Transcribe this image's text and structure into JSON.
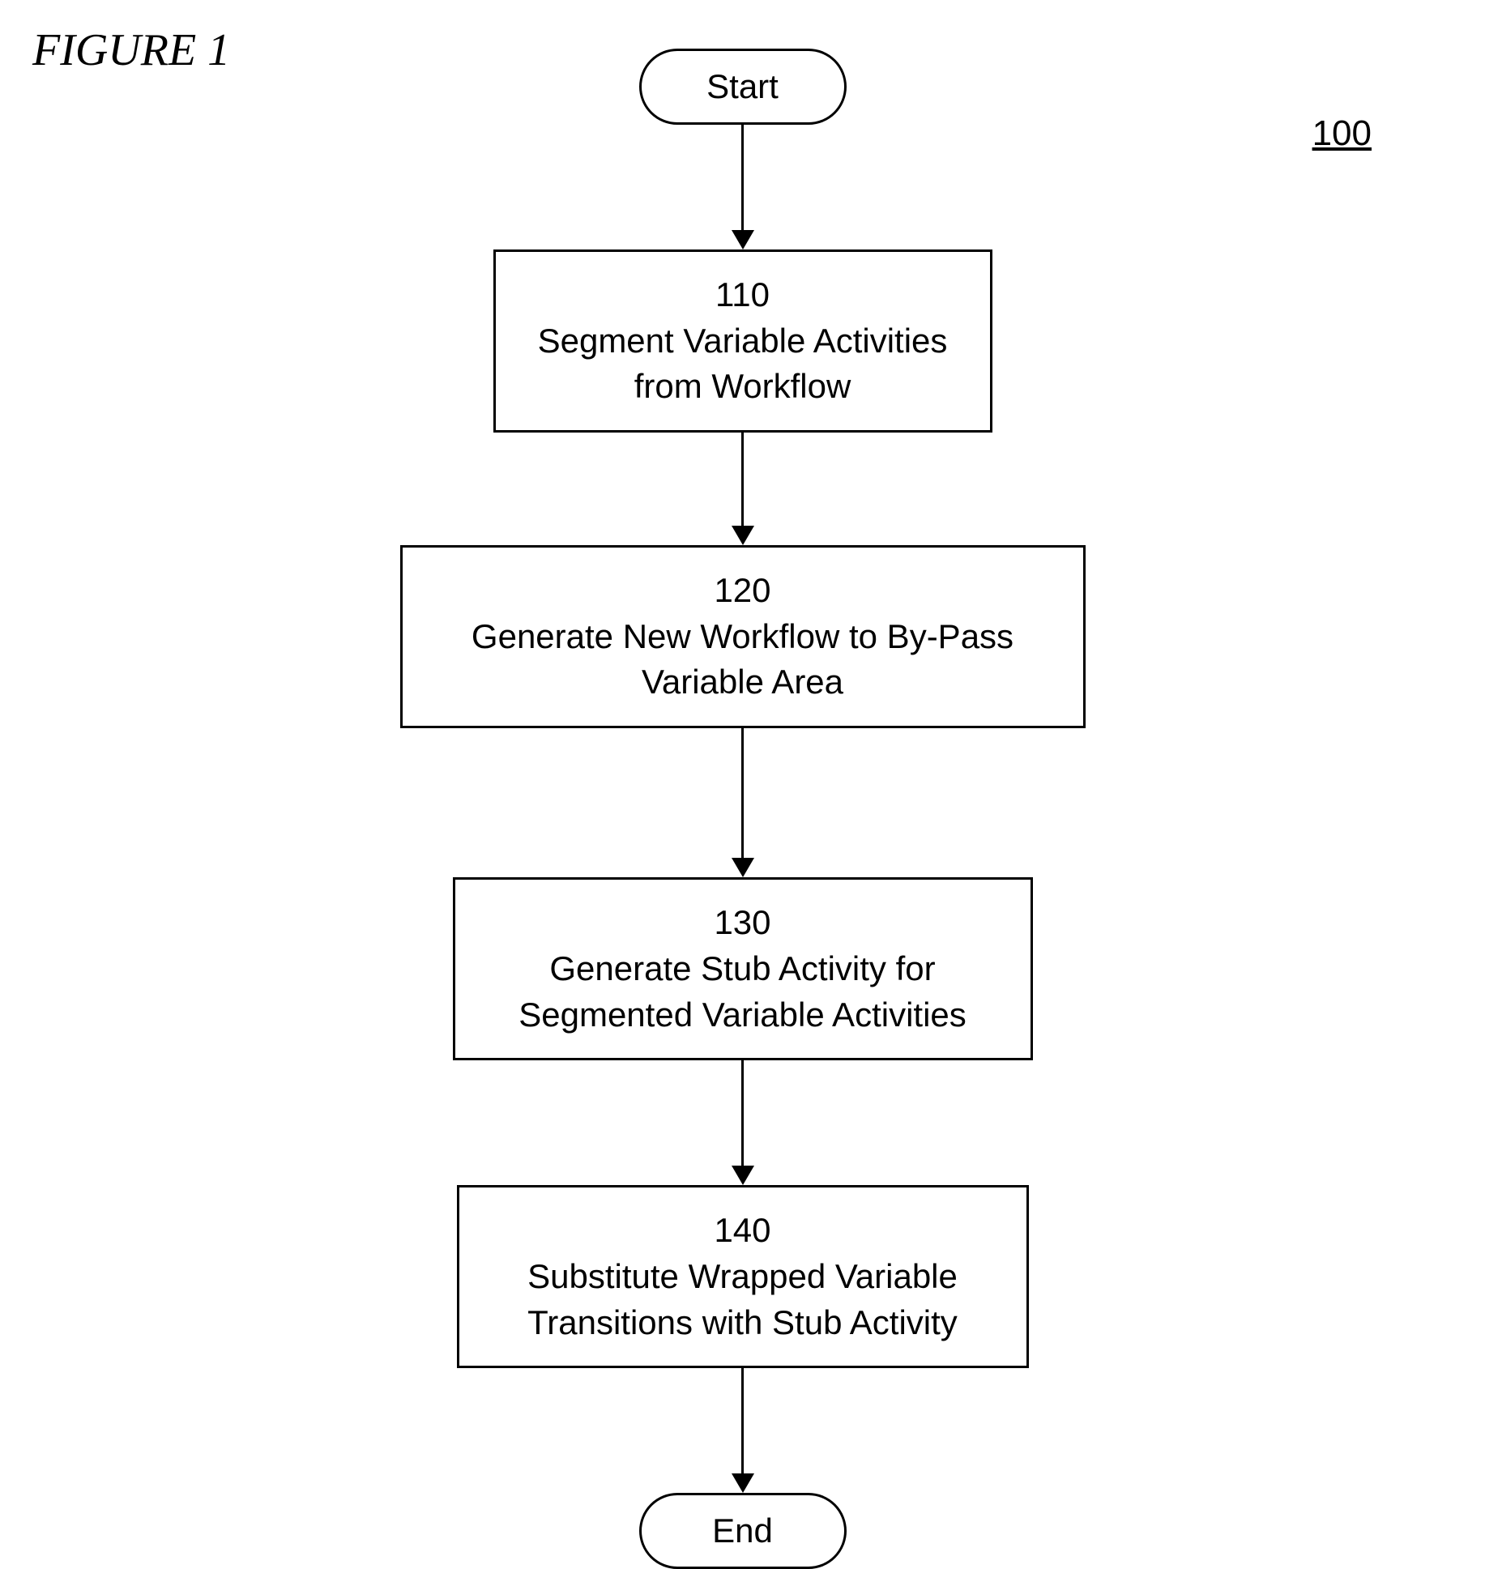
{
  "figure": {
    "label": "FIGURE 1",
    "number": "100"
  },
  "nodes": {
    "start": "Start",
    "end": "End",
    "step110": {
      "number": "110",
      "text": "Segment Variable Activities from Workflow"
    },
    "step120": {
      "number": "120",
      "text": "Generate New Workflow to By-Pass Variable Area"
    },
    "step130": {
      "number": "130",
      "text": "Generate Stub Activity for Segmented Variable Activities"
    },
    "step140": {
      "number": "140",
      "text": "Substitute Wrapped Variable Transitions with Stub Activity"
    }
  }
}
